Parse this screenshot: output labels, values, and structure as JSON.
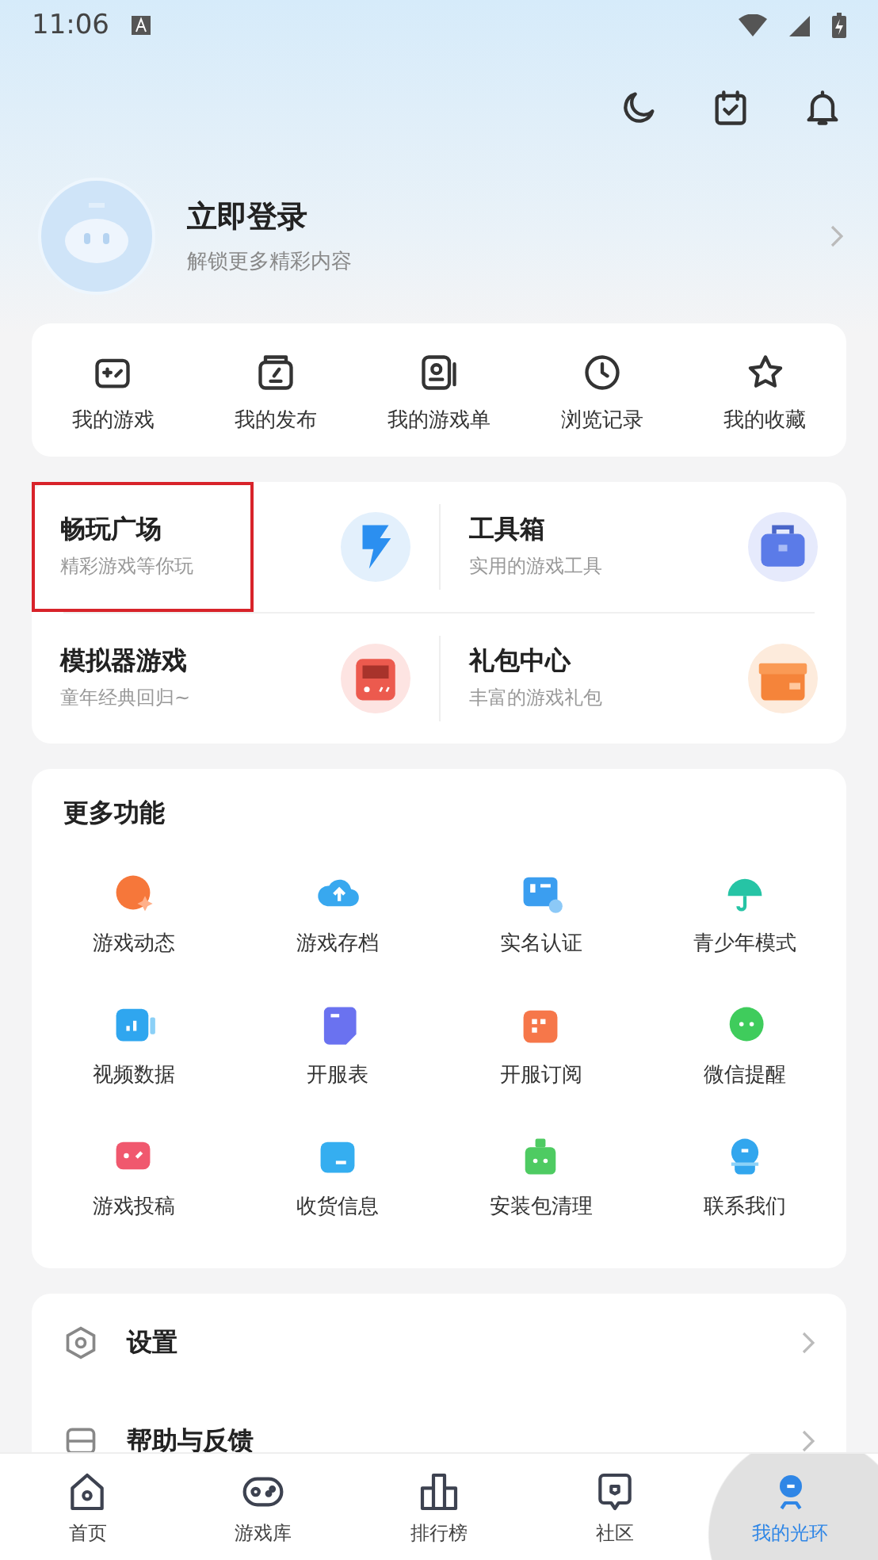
{
  "status_bar": {
    "time": "11:06"
  },
  "profile": {
    "title": "立即登录",
    "subtitle": "解锁更多精彩内容"
  },
  "shortcuts": [
    "我的游戏",
    "我的发布",
    "我的游戏单",
    "浏览记录",
    "我的收藏"
  ],
  "features": [
    {
      "title": "畅玩广场",
      "subtitle": "精彩游戏等你玩",
      "highlighted": true
    },
    {
      "title": "工具箱",
      "subtitle": "实用的游戏工具",
      "highlighted": false
    },
    {
      "title": "模拟器游戏",
      "subtitle": "童年经典回归~",
      "highlighted": false
    },
    {
      "title": "礼包中心",
      "subtitle": "丰富的游戏礼包",
      "highlighted": false
    }
  ],
  "more": {
    "title": "更多功能",
    "items": [
      "游戏动态",
      "游戏存档",
      "实名认证",
      "青少年模式",
      "视频数据",
      "开服表",
      "开服订阅",
      "微信提醒",
      "游戏投稿",
      "收货信息",
      "安装包清理",
      "联系我们"
    ]
  },
  "settings": [
    "设置",
    "帮助与反馈"
  ],
  "nav": [
    {
      "label": "首页",
      "selected": false
    },
    {
      "label": "游戏库",
      "selected": false
    },
    {
      "label": "排行榜",
      "selected": false
    },
    {
      "label": "社区",
      "selected": false
    },
    {
      "label": "我的光环",
      "selected": true
    }
  ]
}
